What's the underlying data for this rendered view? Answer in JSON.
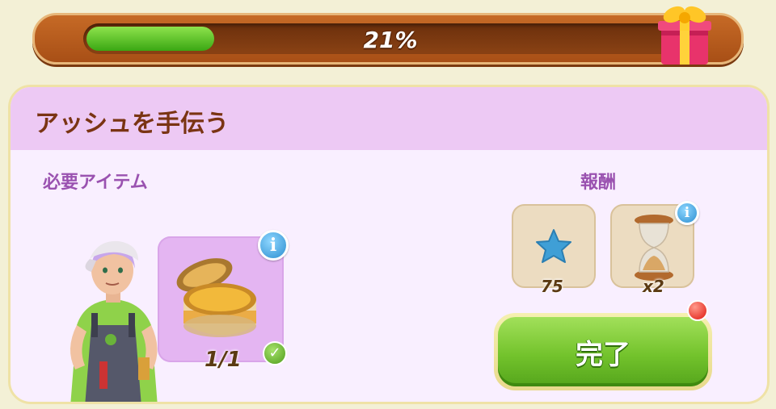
{
  "progress": {
    "value": 0.21,
    "label": "21%"
  },
  "panel": {
    "title": "アッシュを手伝う",
    "required_label": "必要アイテム",
    "reward_label": "報酬"
  },
  "required_item": {
    "icon": "cream-jar-icon",
    "count": "1/1",
    "completed": true
  },
  "rewards": [
    {
      "icon": "blue-star-icon",
      "amount": "75"
    },
    {
      "icon": "hourglass-icon",
      "amount": "x2"
    }
  ],
  "complete_button": {
    "label": "完了"
  },
  "colors": {
    "progress_fill": "#5cc626",
    "button_green": "#73c32c",
    "title_brown": "#7a3413",
    "label_purple": "#9a52b0",
    "notify_red": "#e0180f"
  }
}
